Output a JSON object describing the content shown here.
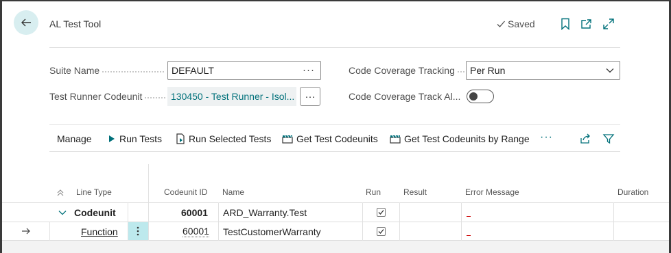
{
  "header": {
    "title": "AL Test Tool",
    "saved_label": "Saved"
  },
  "fields": {
    "suite_name": {
      "label": "Suite Name",
      "value": "DEFAULT"
    },
    "test_runner": {
      "label": "Test Runner Codeunit",
      "value": "130450 - Test Runner - Isol..."
    },
    "coverage_tracking": {
      "label": "Code Coverage Tracking",
      "value": "Per Run"
    },
    "coverage_track_all": {
      "label": "Code Coverage Track Al...",
      "value": false
    }
  },
  "actions": {
    "manage": "Manage",
    "run_tests": "Run Tests",
    "run_selected": "Run Selected Tests",
    "get_codeunits": "Get Test Codeunits",
    "get_by_range": "Get Test Codeunits by Range",
    "more": "···"
  },
  "table": {
    "columns": {
      "line_type": "Line Type",
      "codeunit_id": "Codeunit ID",
      "name": "Name",
      "run": "Run",
      "result": "Result",
      "error": "Error Message",
      "duration": "Duration"
    },
    "rows": [
      {
        "line_type": "Codeunit",
        "codeunit_id": "60001",
        "name": "ARD_Warranty.Test",
        "run": true,
        "result": "",
        "error": "",
        "duration": ""
      },
      {
        "line_type": "Function",
        "codeunit_id": "60001",
        "name": "TestCustomerWarranty",
        "run": true,
        "result": "",
        "error": "",
        "duration": ""
      }
    ]
  },
  "colors": {
    "accent": "#00707a",
    "back_bg": "#d8eef0",
    "selected_cell": "#bde9ed"
  }
}
